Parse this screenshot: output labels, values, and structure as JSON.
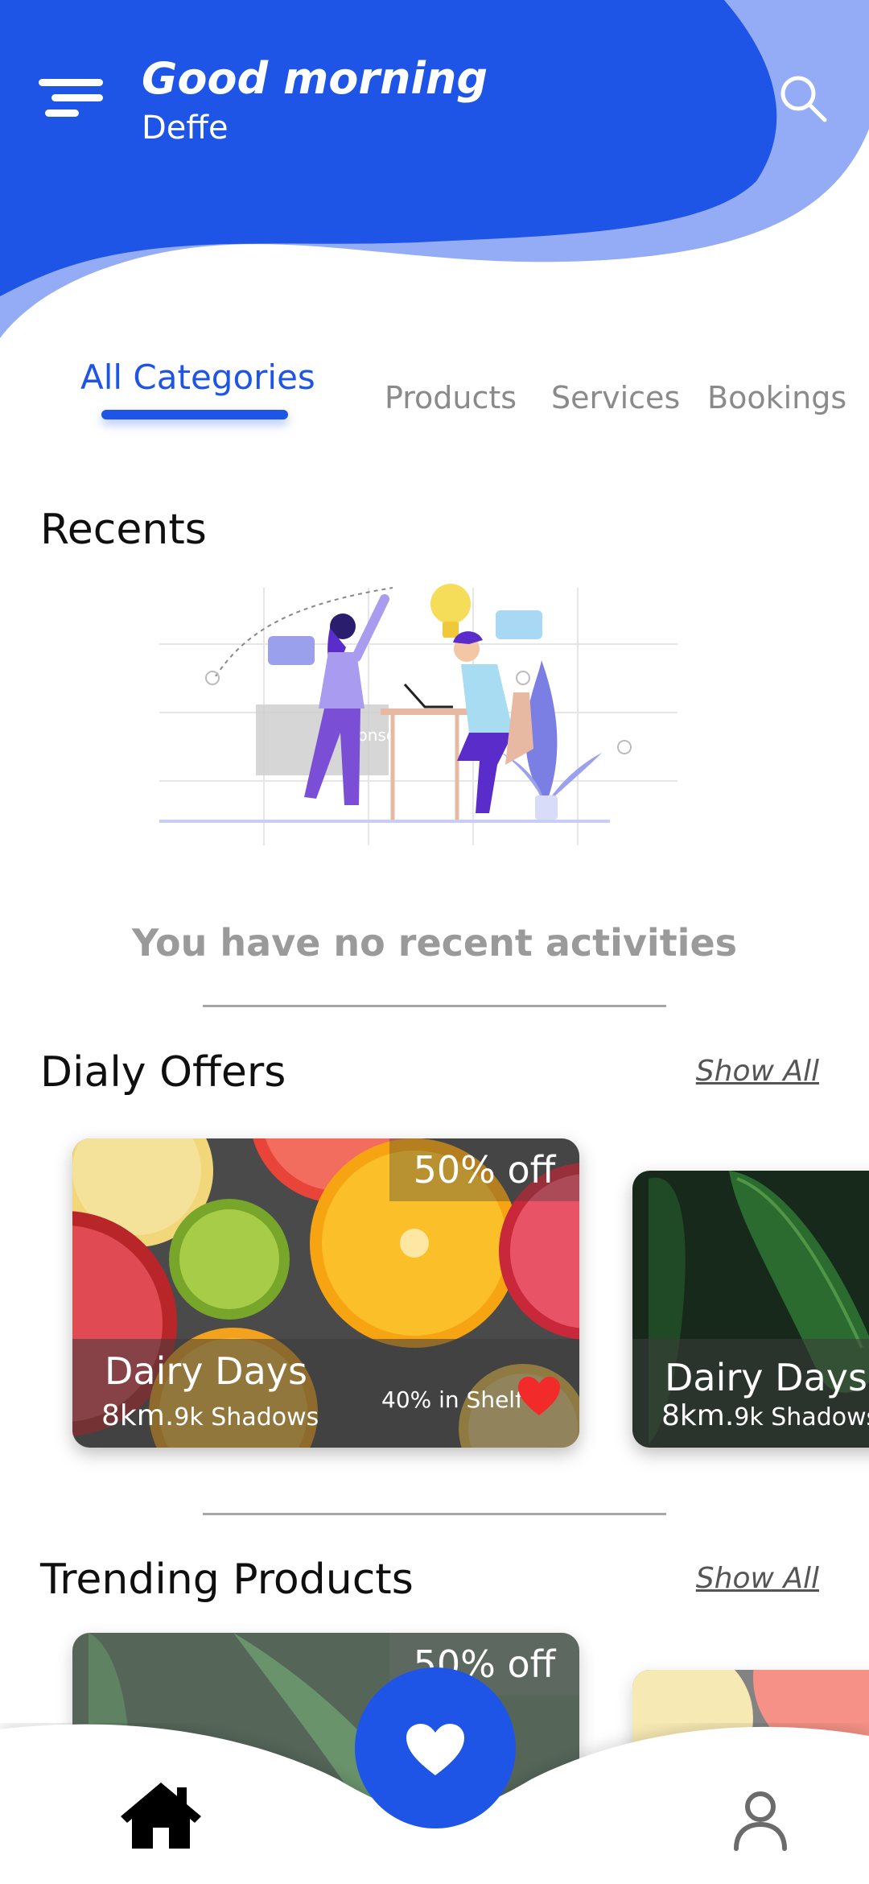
{
  "header": {
    "greeting": "Good morning",
    "username": "Deffe",
    "colors": {
      "primary": "#1f55e6",
      "wave_light": "#93acf5"
    }
  },
  "icons": {
    "menu": "menu-icon",
    "search": "search-icon",
    "heart": "heart-icon",
    "home": "home-icon",
    "profile": "user-icon"
  },
  "tabs": [
    {
      "label": "All Categories",
      "active": true
    },
    {
      "label": "Products",
      "active": false
    },
    {
      "label": "Services",
      "active": false
    },
    {
      "label": "Bookings",
      "active": false
    }
  ],
  "recents": {
    "title": "Recents",
    "illustration_watermark": "iconscout",
    "empty_message": "You have no recent activities"
  },
  "daily_offers": {
    "title": "Dialy Offers",
    "show_all": "Show All",
    "cards": [
      {
        "discount": "50% off",
        "title": "Dairy Days",
        "distance": "8km.",
        "shadows": "9k Shadows",
        "shelf": "40% in Shelf",
        "favorited": true
      },
      {
        "title": "Dairy Days",
        "distance": "8km.",
        "shadows": "9k Shadows"
      }
    ]
  },
  "trending": {
    "title": "Trending Products",
    "show_all": "Show All",
    "cards": [
      {
        "discount": "50% off"
      }
    ]
  }
}
